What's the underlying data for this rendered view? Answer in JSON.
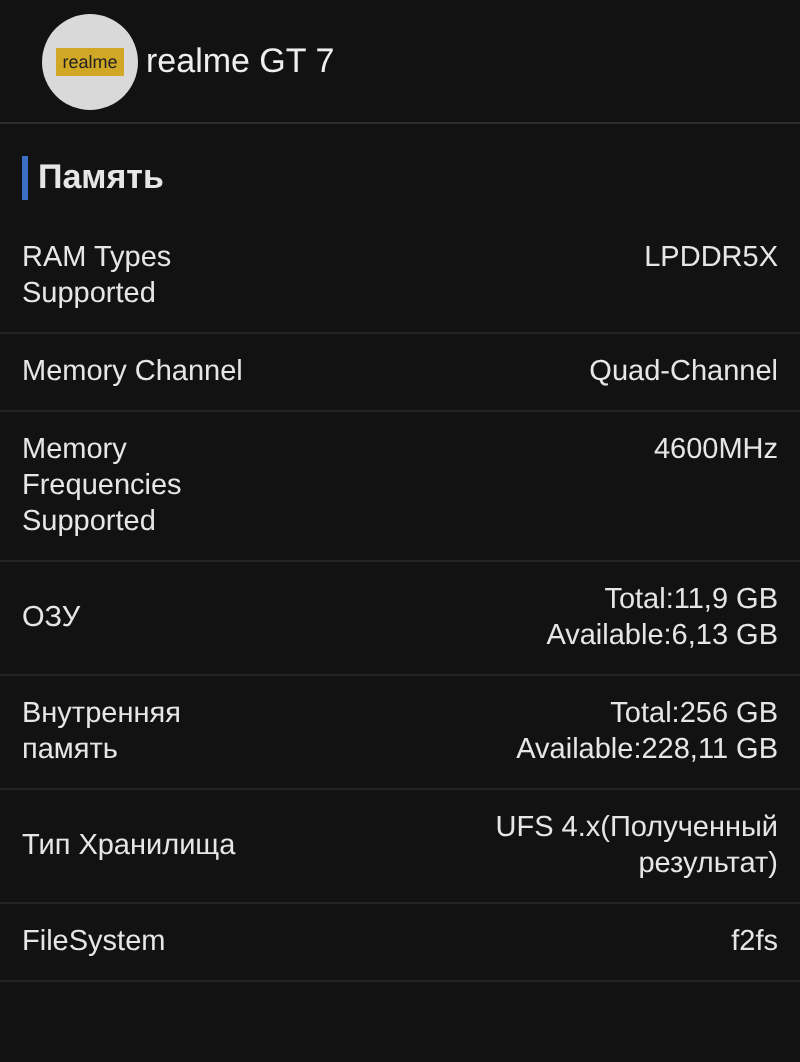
{
  "header": {
    "logo_text": "realme",
    "title": "realme GT 7"
  },
  "section": {
    "title": "Память"
  },
  "rows": [
    {
      "label": [
        "RAM Types",
        "Supported"
      ],
      "value": [
        "LPDDR5X"
      ]
    },
    {
      "label": [
        "Memory Channel"
      ],
      "value": [
        "Quad-Channel"
      ]
    },
    {
      "label": [
        "Memory",
        "Frequencies",
        "Supported"
      ],
      "value": [
        "4600MHz"
      ]
    },
    {
      "label": [
        "ОЗУ"
      ],
      "value": [
        "Total:11,9 GB",
        "Available:6,13 GB"
      ]
    },
    {
      "label": [
        "Внутренняя",
        "память"
      ],
      "value": [
        "Total:256 GB",
        "Available:228,11 GB"
      ]
    },
    {
      "label": [
        "Тип Хранилища"
      ],
      "value": [
        "UFS 4.x(Полученный",
        "результат)"
      ]
    },
    {
      "label": [
        "FileSystem"
      ],
      "value": [
        "f2fs"
      ]
    }
  ]
}
